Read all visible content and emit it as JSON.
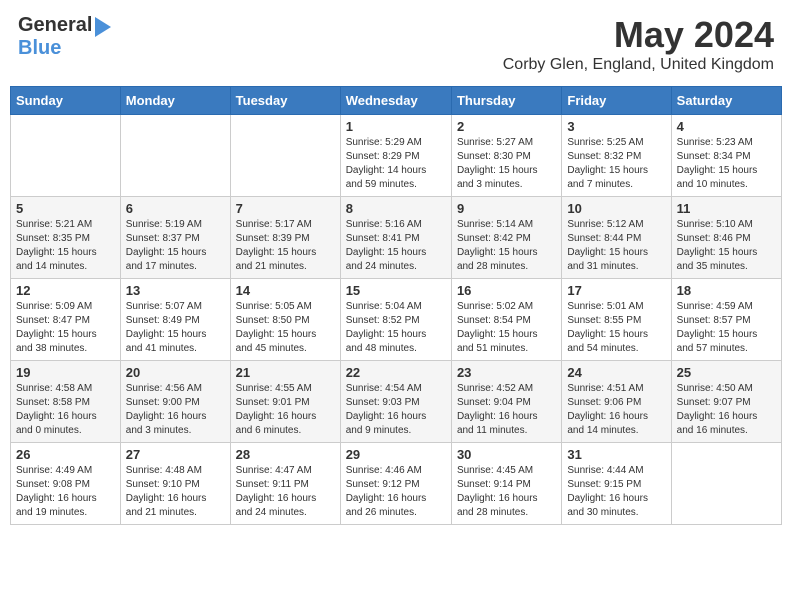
{
  "header": {
    "logo": {
      "general": "General",
      "blue": "Blue",
      "arrow": "▶"
    },
    "title": "May 2024",
    "location": "Corby Glen, England, United Kingdom"
  },
  "days_of_week": [
    "Sunday",
    "Monday",
    "Tuesday",
    "Wednesday",
    "Thursday",
    "Friday",
    "Saturday"
  ],
  "weeks": [
    [
      {
        "day": "",
        "info": ""
      },
      {
        "day": "",
        "info": ""
      },
      {
        "day": "",
        "info": ""
      },
      {
        "day": "1",
        "info": "Sunrise: 5:29 AM\nSunset: 8:29 PM\nDaylight: 14 hours\nand 59 minutes."
      },
      {
        "day": "2",
        "info": "Sunrise: 5:27 AM\nSunset: 8:30 PM\nDaylight: 15 hours\nand 3 minutes."
      },
      {
        "day": "3",
        "info": "Sunrise: 5:25 AM\nSunset: 8:32 PM\nDaylight: 15 hours\nand 7 minutes."
      },
      {
        "day": "4",
        "info": "Sunrise: 5:23 AM\nSunset: 8:34 PM\nDaylight: 15 hours\nand 10 minutes."
      }
    ],
    [
      {
        "day": "5",
        "info": "Sunrise: 5:21 AM\nSunset: 8:35 PM\nDaylight: 15 hours\nand 14 minutes."
      },
      {
        "day": "6",
        "info": "Sunrise: 5:19 AM\nSunset: 8:37 PM\nDaylight: 15 hours\nand 17 minutes."
      },
      {
        "day": "7",
        "info": "Sunrise: 5:17 AM\nSunset: 8:39 PM\nDaylight: 15 hours\nand 21 minutes."
      },
      {
        "day": "8",
        "info": "Sunrise: 5:16 AM\nSunset: 8:41 PM\nDaylight: 15 hours\nand 24 minutes."
      },
      {
        "day": "9",
        "info": "Sunrise: 5:14 AM\nSunset: 8:42 PM\nDaylight: 15 hours\nand 28 minutes."
      },
      {
        "day": "10",
        "info": "Sunrise: 5:12 AM\nSunset: 8:44 PM\nDaylight: 15 hours\nand 31 minutes."
      },
      {
        "day": "11",
        "info": "Sunrise: 5:10 AM\nSunset: 8:46 PM\nDaylight: 15 hours\nand 35 minutes."
      }
    ],
    [
      {
        "day": "12",
        "info": "Sunrise: 5:09 AM\nSunset: 8:47 PM\nDaylight: 15 hours\nand 38 minutes."
      },
      {
        "day": "13",
        "info": "Sunrise: 5:07 AM\nSunset: 8:49 PM\nDaylight: 15 hours\nand 41 minutes."
      },
      {
        "day": "14",
        "info": "Sunrise: 5:05 AM\nSunset: 8:50 PM\nDaylight: 15 hours\nand 45 minutes."
      },
      {
        "day": "15",
        "info": "Sunrise: 5:04 AM\nSunset: 8:52 PM\nDaylight: 15 hours\nand 48 minutes."
      },
      {
        "day": "16",
        "info": "Sunrise: 5:02 AM\nSunset: 8:54 PM\nDaylight: 15 hours\nand 51 minutes."
      },
      {
        "day": "17",
        "info": "Sunrise: 5:01 AM\nSunset: 8:55 PM\nDaylight: 15 hours\nand 54 minutes."
      },
      {
        "day": "18",
        "info": "Sunrise: 4:59 AM\nSunset: 8:57 PM\nDaylight: 15 hours\nand 57 minutes."
      }
    ],
    [
      {
        "day": "19",
        "info": "Sunrise: 4:58 AM\nSunset: 8:58 PM\nDaylight: 16 hours\nand 0 minutes."
      },
      {
        "day": "20",
        "info": "Sunrise: 4:56 AM\nSunset: 9:00 PM\nDaylight: 16 hours\nand 3 minutes."
      },
      {
        "day": "21",
        "info": "Sunrise: 4:55 AM\nSunset: 9:01 PM\nDaylight: 16 hours\nand 6 minutes."
      },
      {
        "day": "22",
        "info": "Sunrise: 4:54 AM\nSunset: 9:03 PM\nDaylight: 16 hours\nand 9 minutes."
      },
      {
        "day": "23",
        "info": "Sunrise: 4:52 AM\nSunset: 9:04 PM\nDaylight: 16 hours\nand 11 minutes."
      },
      {
        "day": "24",
        "info": "Sunrise: 4:51 AM\nSunset: 9:06 PM\nDaylight: 16 hours\nand 14 minutes."
      },
      {
        "day": "25",
        "info": "Sunrise: 4:50 AM\nSunset: 9:07 PM\nDaylight: 16 hours\nand 16 minutes."
      }
    ],
    [
      {
        "day": "26",
        "info": "Sunrise: 4:49 AM\nSunset: 9:08 PM\nDaylight: 16 hours\nand 19 minutes."
      },
      {
        "day": "27",
        "info": "Sunrise: 4:48 AM\nSunset: 9:10 PM\nDaylight: 16 hours\nand 21 minutes."
      },
      {
        "day": "28",
        "info": "Sunrise: 4:47 AM\nSunset: 9:11 PM\nDaylight: 16 hours\nand 24 minutes."
      },
      {
        "day": "29",
        "info": "Sunrise: 4:46 AM\nSunset: 9:12 PM\nDaylight: 16 hours\nand 26 minutes."
      },
      {
        "day": "30",
        "info": "Sunrise: 4:45 AM\nSunset: 9:14 PM\nDaylight: 16 hours\nand 28 minutes."
      },
      {
        "day": "31",
        "info": "Sunrise: 4:44 AM\nSunset: 9:15 PM\nDaylight: 16 hours\nand 30 minutes."
      },
      {
        "day": "",
        "info": ""
      }
    ]
  ]
}
